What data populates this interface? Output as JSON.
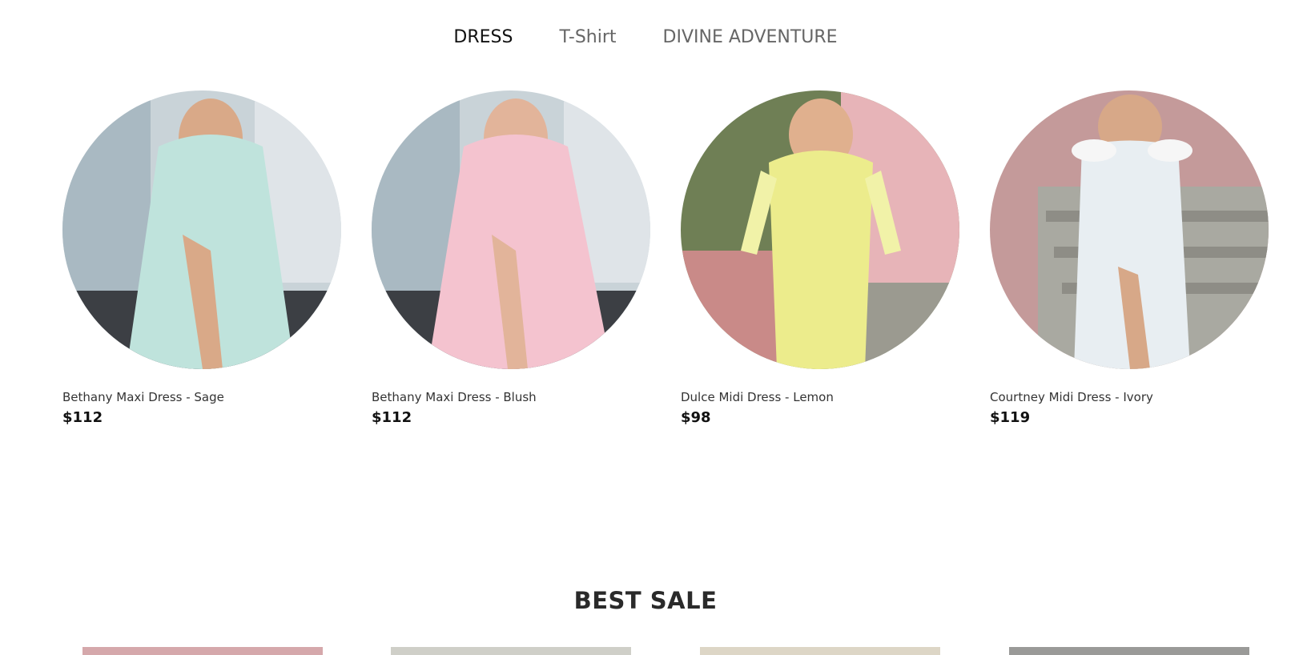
{
  "tabs": [
    {
      "label": "DRESS",
      "active": true
    },
    {
      "label": "T-Shirt",
      "active": false
    },
    {
      "label": "DIVINE ADVENTURE",
      "active": false
    }
  ],
  "products": [
    {
      "name": "Bethany Maxi Dress - Sage",
      "price": "$112",
      "dress_color": "#bfe3dc",
      "bg_color": "#c9d3d8"
    },
    {
      "name": "Bethany Maxi Dress - Blush",
      "price": "$112",
      "dress_color": "#f4c3cf",
      "bg_color": "#c9d3d8"
    },
    {
      "name": "Dulce Midi Dress - Lemon",
      "price": "$98",
      "dress_color": "#ecec8c",
      "bg_color": "#6f7f55"
    },
    {
      "name": "Courtney Midi Dress - Ivory",
      "price": "$119",
      "dress_color": "#e8eef2",
      "bg_color": "#c49a9a"
    }
  ],
  "best_sale": {
    "title": "BEST SALE",
    "thumb_colors": [
      "#d5a8ab",
      "#cfcfc8",
      "#ddd6c6",
      "#9a9a98"
    ]
  }
}
